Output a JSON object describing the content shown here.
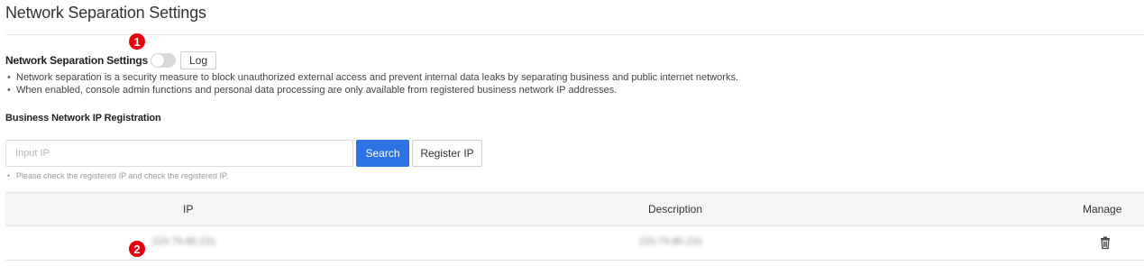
{
  "header": {
    "title": "Network Separation Settings"
  },
  "setting": {
    "label": "Network Separation Settings",
    "toggle_on": false,
    "log_label": "Log"
  },
  "notes": [
    "Network separation is a security measure to block unauthorized external access and prevent internal data leaks by separating business and public internet networks.",
    "When enabled, console admin functions and personal data processing are only available from registered business network IP addresses."
  ],
  "registration": {
    "title": "Business Network IP Registration",
    "input_placeholder": "Input IP",
    "search_label": "Search",
    "register_label": "Register IP",
    "hint": "Please check the registered IP and check the registered IP."
  },
  "table": {
    "columns": [
      "IP",
      "Description",
      "Manage"
    ],
    "rows": [
      {
        "ip": "220.79.80.231",
        "description": "220.79.80.231"
      }
    ]
  },
  "markers": [
    "1",
    "2"
  ],
  "icons": {
    "delete": "trash-icon"
  },
  "colors": {
    "primary": "#2e73e6",
    "marker": "#e8000b",
    "toggle_off": "#d9d9d9"
  }
}
